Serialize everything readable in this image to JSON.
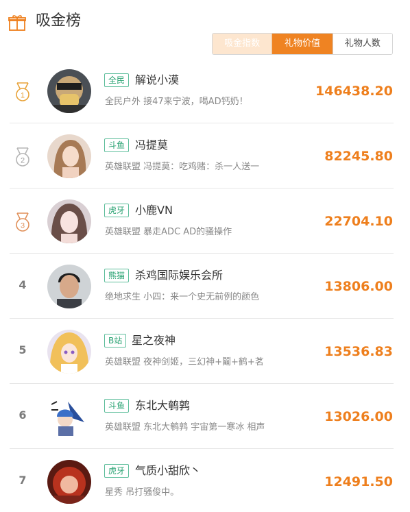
{
  "header": {
    "title": "吸金榜",
    "icon": "gift-icon",
    "accent": "#ee7f1d"
  },
  "tabs": [
    {
      "label": "吸金指数",
      "active": false
    },
    {
      "label": "礼物价值",
      "active": true
    },
    {
      "label": "礼物人数",
      "active": false
    }
  ],
  "rows": [
    {
      "rank": "1",
      "medal": true,
      "platform": "全民",
      "name": "解说小漠",
      "desc": "全民户外 接47来宁波，喝AD钙奶！",
      "value": "146438.20"
    },
    {
      "rank": "2",
      "medal": true,
      "platform": "斗鱼",
      "name": "冯提莫",
      "desc": "英雄联盟 冯提莫：吃鸡赌：杀一人送一",
      "value": "82245.80"
    },
    {
      "rank": "3",
      "medal": true,
      "platform": "虎牙",
      "name": "小鹿VN",
      "desc": "英雄联盟 暴走ADC AD的骚操作",
      "value": "22704.10"
    },
    {
      "rank": "4",
      "medal": false,
      "platform": "熊猫",
      "name": "杀鸡国际娱乐会所",
      "desc": "绝地求生 小四：来一个史无前例的颜色",
      "value": "13806.00"
    },
    {
      "rank": "5",
      "medal": false,
      "platform": "B站",
      "name": "星之夜神",
      "desc": "英雄联盟 夜神剑姬，三幻神+鬮+鹤+茗",
      "value": "13536.83"
    },
    {
      "rank": "6",
      "medal": false,
      "platform": "斗鱼",
      "name": "东北大鹌鹑",
      "desc": "英雄联盟 东北大鹌鹑 宇宙第一寒冰 相声",
      "value": "13026.00"
    },
    {
      "rank": "7",
      "medal": false,
      "platform": "虎牙",
      "name": "气质小甜欣丶",
      "desc": "星秀 吊打骚俊中。",
      "value": "12491.50"
    }
  ]
}
